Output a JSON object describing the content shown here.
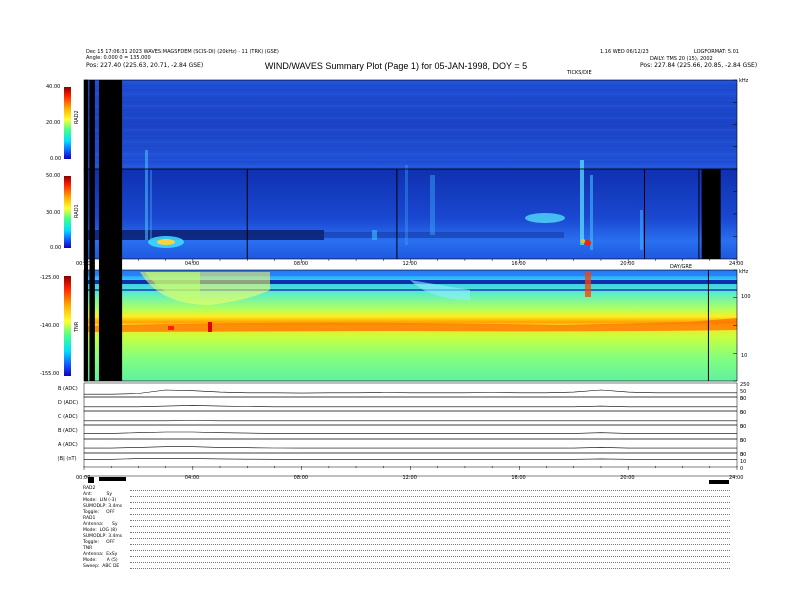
{
  "header": {
    "left_line1": "Dec 15 17:06:31 2023 WAVES:MAGSFDEM (SCIS-DI) (20kHz) · 11 (TRK) (GSE)",
    "left_line2": "Angle: 0.000 0 = 135.000",
    "left_line3": "Pos: 227.40 (225.63, 20.71, -2.84 GSE)",
    "right_line1_a": "1.16 WED 06/12/23",
    "right_line1_b": "LOGFORMAT: 5.01",
    "right_line2": "DAILY: TMS 20 (15), 2002",
    "right_line3": "Pos: 227.84 (225.66, 20.85, -2.84 GSE)",
    "ticks_label": "TICKS/DIE"
  },
  "title": "WIND/WAVES Summary Plot (Page 1) for 05-JAN-1998, DOY = 5",
  "panels": {
    "rad2": {
      "label": "RAD2",
      "ticks": [
        "40.00",
        "20.00",
        "0.00"
      ]
    },
    "rad1": {
      "label": "RAD1",
      "ticks": [
        "50.00",
        "30.00",
        "0.00"
      ]
    },
    "tnr": {
      "label": "TNR",
      "ticks": [
        "-125.00",
        "-140.00",
        "-155.00"
      ]
    },
    "tnr_right_ticks": [
      "100",
      "10"
    ],
    "top_right_unit": "kHz",
    "mid_right_unit": "kHz"
  },
  "time_axis": [
    "00:00",
    "04:00",
    "08:00",
    "12:00",
    "16:00",
    "20:00",
    "24:00"
  ],
  "time_axis_mid_label": "DAY/GRE",
  "chart_data": {
    "type": "heatmap",
    "title": "WIND/WAVES Summary Plot (Page 1) for 05-JAN-1998, DOY = 5",
    "x_range_hours": [
      0,
      24
    ],
    "panels": [
      {
        "name": "RAD2",
        "y_ticks": [
          40,
          20,
          0
        ]
      },
      {
        "name": "RAD1",
        "y_ticks": [
          50,
          30,
          0
        ]
      },
      {
        "name": "TNR",
        "y_ticks": [
          -125,
          -140,
          -155
        ],
        "right_axis_ticks": [
          100,
          10
        ]
      }
    ],
    "data_gaps_hours": [
      [
        0.0,
        0.15
      ],
      [
        0.2,
        0.4
      ],
      [
        0.55,
        1.4
      ],
      [
        22.7,
        23.4
      ]
    ],
    "line_series": [
      {
        "name": "B (ADC)",
        "right_ticks": [
          250,
          50,
          0
        ],
        "values": [
          0.2,
          0.2,
          0.25,
          0.5,
          0.45,
          0.35,
          0.3,
          0.3,
          0.28,
          0.3,
          0.3,
          0.32,
          0.3,
          0.3,
          0.3,
          0.32,
          0.3,
          0.3,
          0.35,
          0.5,
          0.35,
          0.3,
          0.3,
          0.3,
          0.3
        ]
      },
      {
        "name": "D (ADC)",
        "right_ticks": [
          50,
          0
        ],
        "values": [
          0.3,
          0.3,
          0.3,
          0.35,
          0.4,
          0.35,
          0.32,
          0.3,
          0.3,
          0.3,
          0.3,
          0.3,
          0.3,
          0.3,
          0.3,
          0.3,
          0.3,
          0.3,
          0.3,
          0.35,
          0.3,
          0.3,
          0.3,
          0.3,
          0.3
        ]
      },
      {
        "name": "C (ADC)",
        "right_ticks": [
          50,
          0
        ],
        "values": [
          0.3,
          0.3,
          0.3,
          0.3,
          0.32,
          0.3,
          0.3,
          0.3,
          0.3,
          0.3,
          0.3,
          0.3,
          0.3,
          0.3,
          0.3,
          0.3,
          0.3,
          0.3,
          0.3,
          0.3,
          0.3,
          0.3,
          0.3,
          0.3,
          0.3
        ]
      },
      {
        "name": "B (ADC)",
        "right_ticks": [
          50,
          0
        ],
        "values": [
          0.4,
          0.4,
          0.45,
          0.5,
          0.5,
          0.45,
          0.42,
          0.4,
          0.4,
          0.4,
          0.4,
          0.4,
          0.4,
          0.4,
          0.4,
          0.4,
          0.4,
          0.4,
          0.4,
          0.45,
          0.4,
          0.4,
          0.4,
          0.4,
          0.4
        ]
      },
      {
        "name": "A (ADC)",
        "right_ticks": [
          50,
          0
        ],
        "values": [
          0.35,
          0.35,
          0.4,
          0.45,
          0.45,
          0.4,
          0.38,
          0.36,
          0.35,
          0.35,
          0.35,
          0.35,
          0.35,
          0.35,
          0.35,
          0.35,
          0.35,
          0.35,
          0.35,
          0.4,
          0.35,
          0.35,
          0.35,
          0.35,
          0.35
        ]
      },
      {
        "name": "|B| (nT)",
        "right_ticks": [
          30,
          10,
          0
        ],
        "values": [
          0.55,
          0.55,
          0.6,
          0.62,
          0.6,
          0.58,
          0.56,
          0.55,
          0.55,
          0.55,
          0.55,
          0.55,
          0.55,
          0.55,
          0.55,
          0.55,
          0.55,
          0.55,
          0.55,
          0.58,
          0.55,
          0.55,
          0.55,
          0.55,
          0.55
        ]
      }
    ]
  },
  "status_block": [
    "RAD2",
    "Ant:          Sy",
    "Mode:  LIN (-3)",
    "SUMODLP: 3.4ms",
    "Toggle:     OFF",
    "RAD1",
    "Antenna:      Sy",
    "Mode:  LOG (8)",
    "SUMODLP: 3.4ms",
    "Toggle:     OFF",
    "TNR",
    "Antenna:  ExSy",
    "Mode:       A (5)",
    "Sweep:  ABC DE"
  ],
  "colors": {
    "bg_blue": "#1a46c8",
    "data_gap": "#000000",
    "colorbar_top": "#b00000",
    "colorbar_bottom": "#1010ff"
  }
}
